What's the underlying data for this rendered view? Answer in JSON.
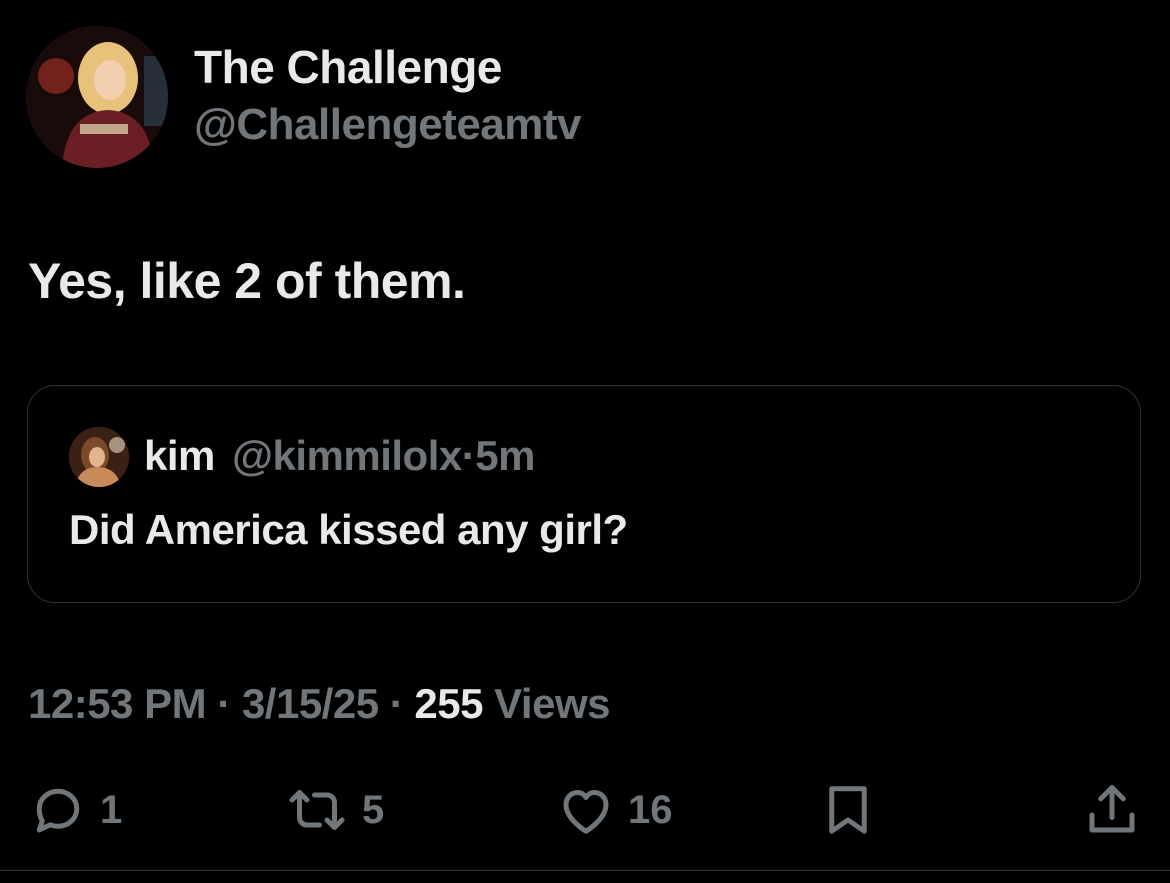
{
  "author": {
    "display_name": "The Challenge",
    "handle": "@Challengeteamtv"
  },
  "tweet": {
    "text": "Yes, like 2 of them."
  },
  "quoted_tweet": {
    "name": "kim",
    "handle": "@kimmilolx",
    "separator": "·",
    "time": "5m",
    "text": "Did America kissed any girl?"
  },
  "meta": {
    "time": "12:53 PM",
    "sep1": "·",
    "date": "3/15/25",
    "sep2": "·",
    "views_count": "255",
    "views_label": "Views"
  },
  "actions": {
    "reply_count": "1",
    "retweet_count": "5",
    "like_count": "16"
  },
  "icons": {
    "reply": "reply-bubble-icon",
    "retweet": "retweet-icon",
    "like": "heart-icon",
    "bookmark": "bookmark-icon",
    "share": "share-upload-icon"
  },
  "colors": {
    "background": "#000000",
    "text": "#e7e9ea",
    "muted": "#71767b",
    "border": "#2f3336"
  }
}
